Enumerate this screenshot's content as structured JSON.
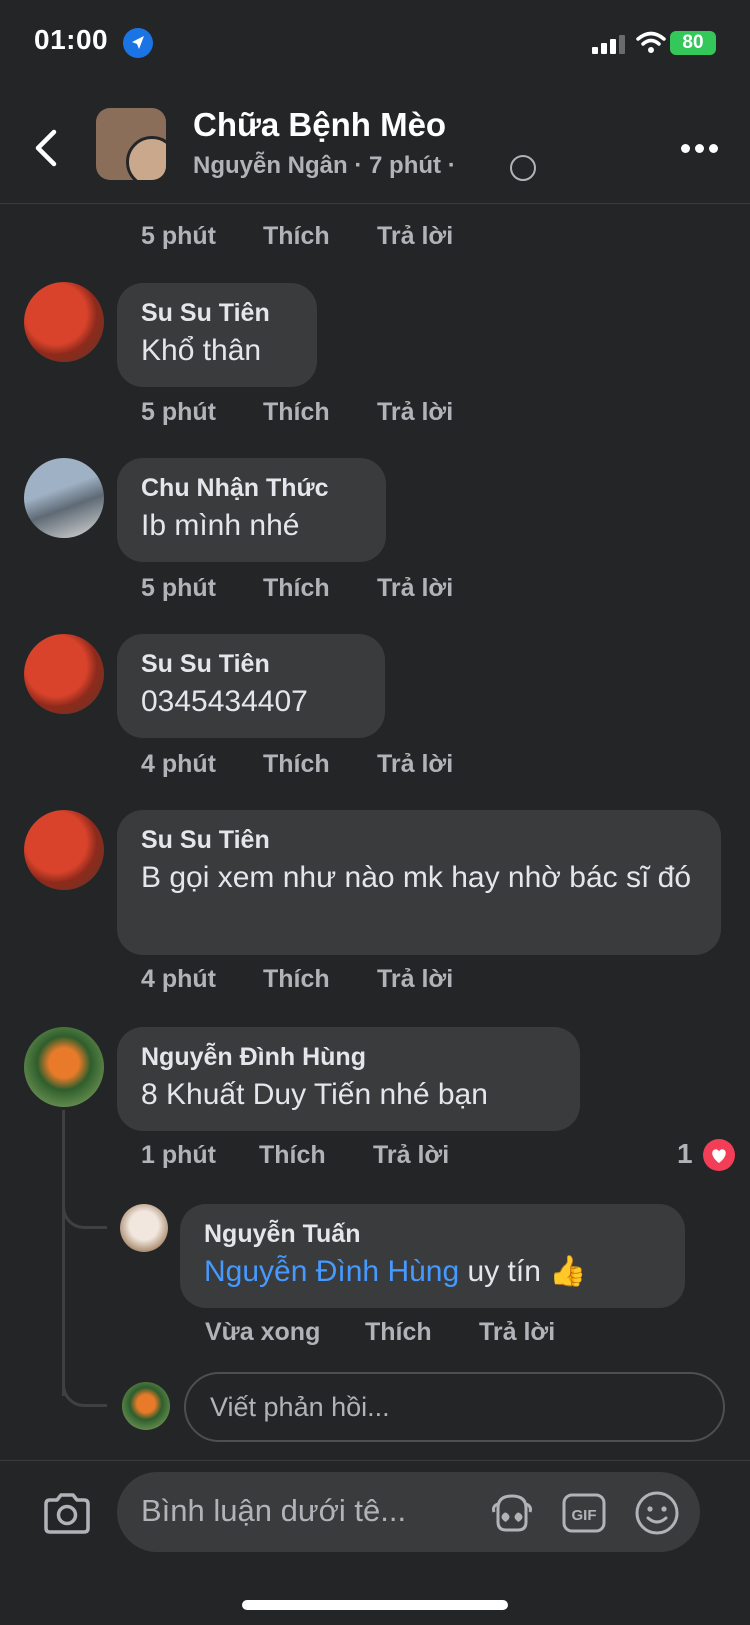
{
  "status_bar": {
    "time": "01:00",
    "battery": "80"
  },
  "header": {
    "title": "Chữa Bệnh Mèo",
    "author": "Nguyễn Ngân",
    "time": "7 phút"
  },
  "actions_labels": {
    "like": "Thích",
    "reply": "Trả lời"
  },
  "prev_comment": {
    "time": "5 phút"
  },
  "comments": [
    {
      "name": "Su Su Tiên",
      "text": "Khổ thân",
      "time": "5 phút"
    },
    {
      "name": "Chu Nhận Thức",
      "text": "Ib mình nhé",
      "time": "5 phút"
    },
    {
      "name": "Su Su Tiên",
      "text": "0345434407",
      "time": "4 phút"
    },
    {
      "name": "Su Su Tiên",
      "text": "B gọi xem như nào mk hay nhờ bác sĩ đó",
      "time": "4 phút"
    },
    {
      "name": "Nguyễn Đình Hùng",
      "text": "8 Khuất Duy Tiến nhé bạn",
      "time": "1 phút",
      "reaction_count": "1",
      "reaction": "heart"
    }
  ],
  "reply": {
    "name": "Nguyễn Tuấn",
    "mention": "Nguyễn Đình Hùng",
    "text": "uy tín 👍",
    "time": "Vừa xong"
  },
  "reply_input": {
    "placeholder": "Viết phản hồi..."
  },
  "composer": {
    "placeholder": "Bình luận dưới tê..."
  },
  "icons": {
    "location": "location-arrow-icon",
    "back": "chevron-left-icon",
    "globe": "globe-icon",
    "more": "more-dots-icon",
    "camera": "camera-icon",
    "sticker": "sticker-icon",
    "gif": "gif-icon",
    "emoji": "emoji-icon",
    "heart": "heart-reaction-icon"
  },
  "colors": {
    "background": "#242526",
    "bubble": "#3a3b3c",
    "mention": "#4599ff",
    "heart": "#f33e58",
    "battery": "#34c759"
  }
}
